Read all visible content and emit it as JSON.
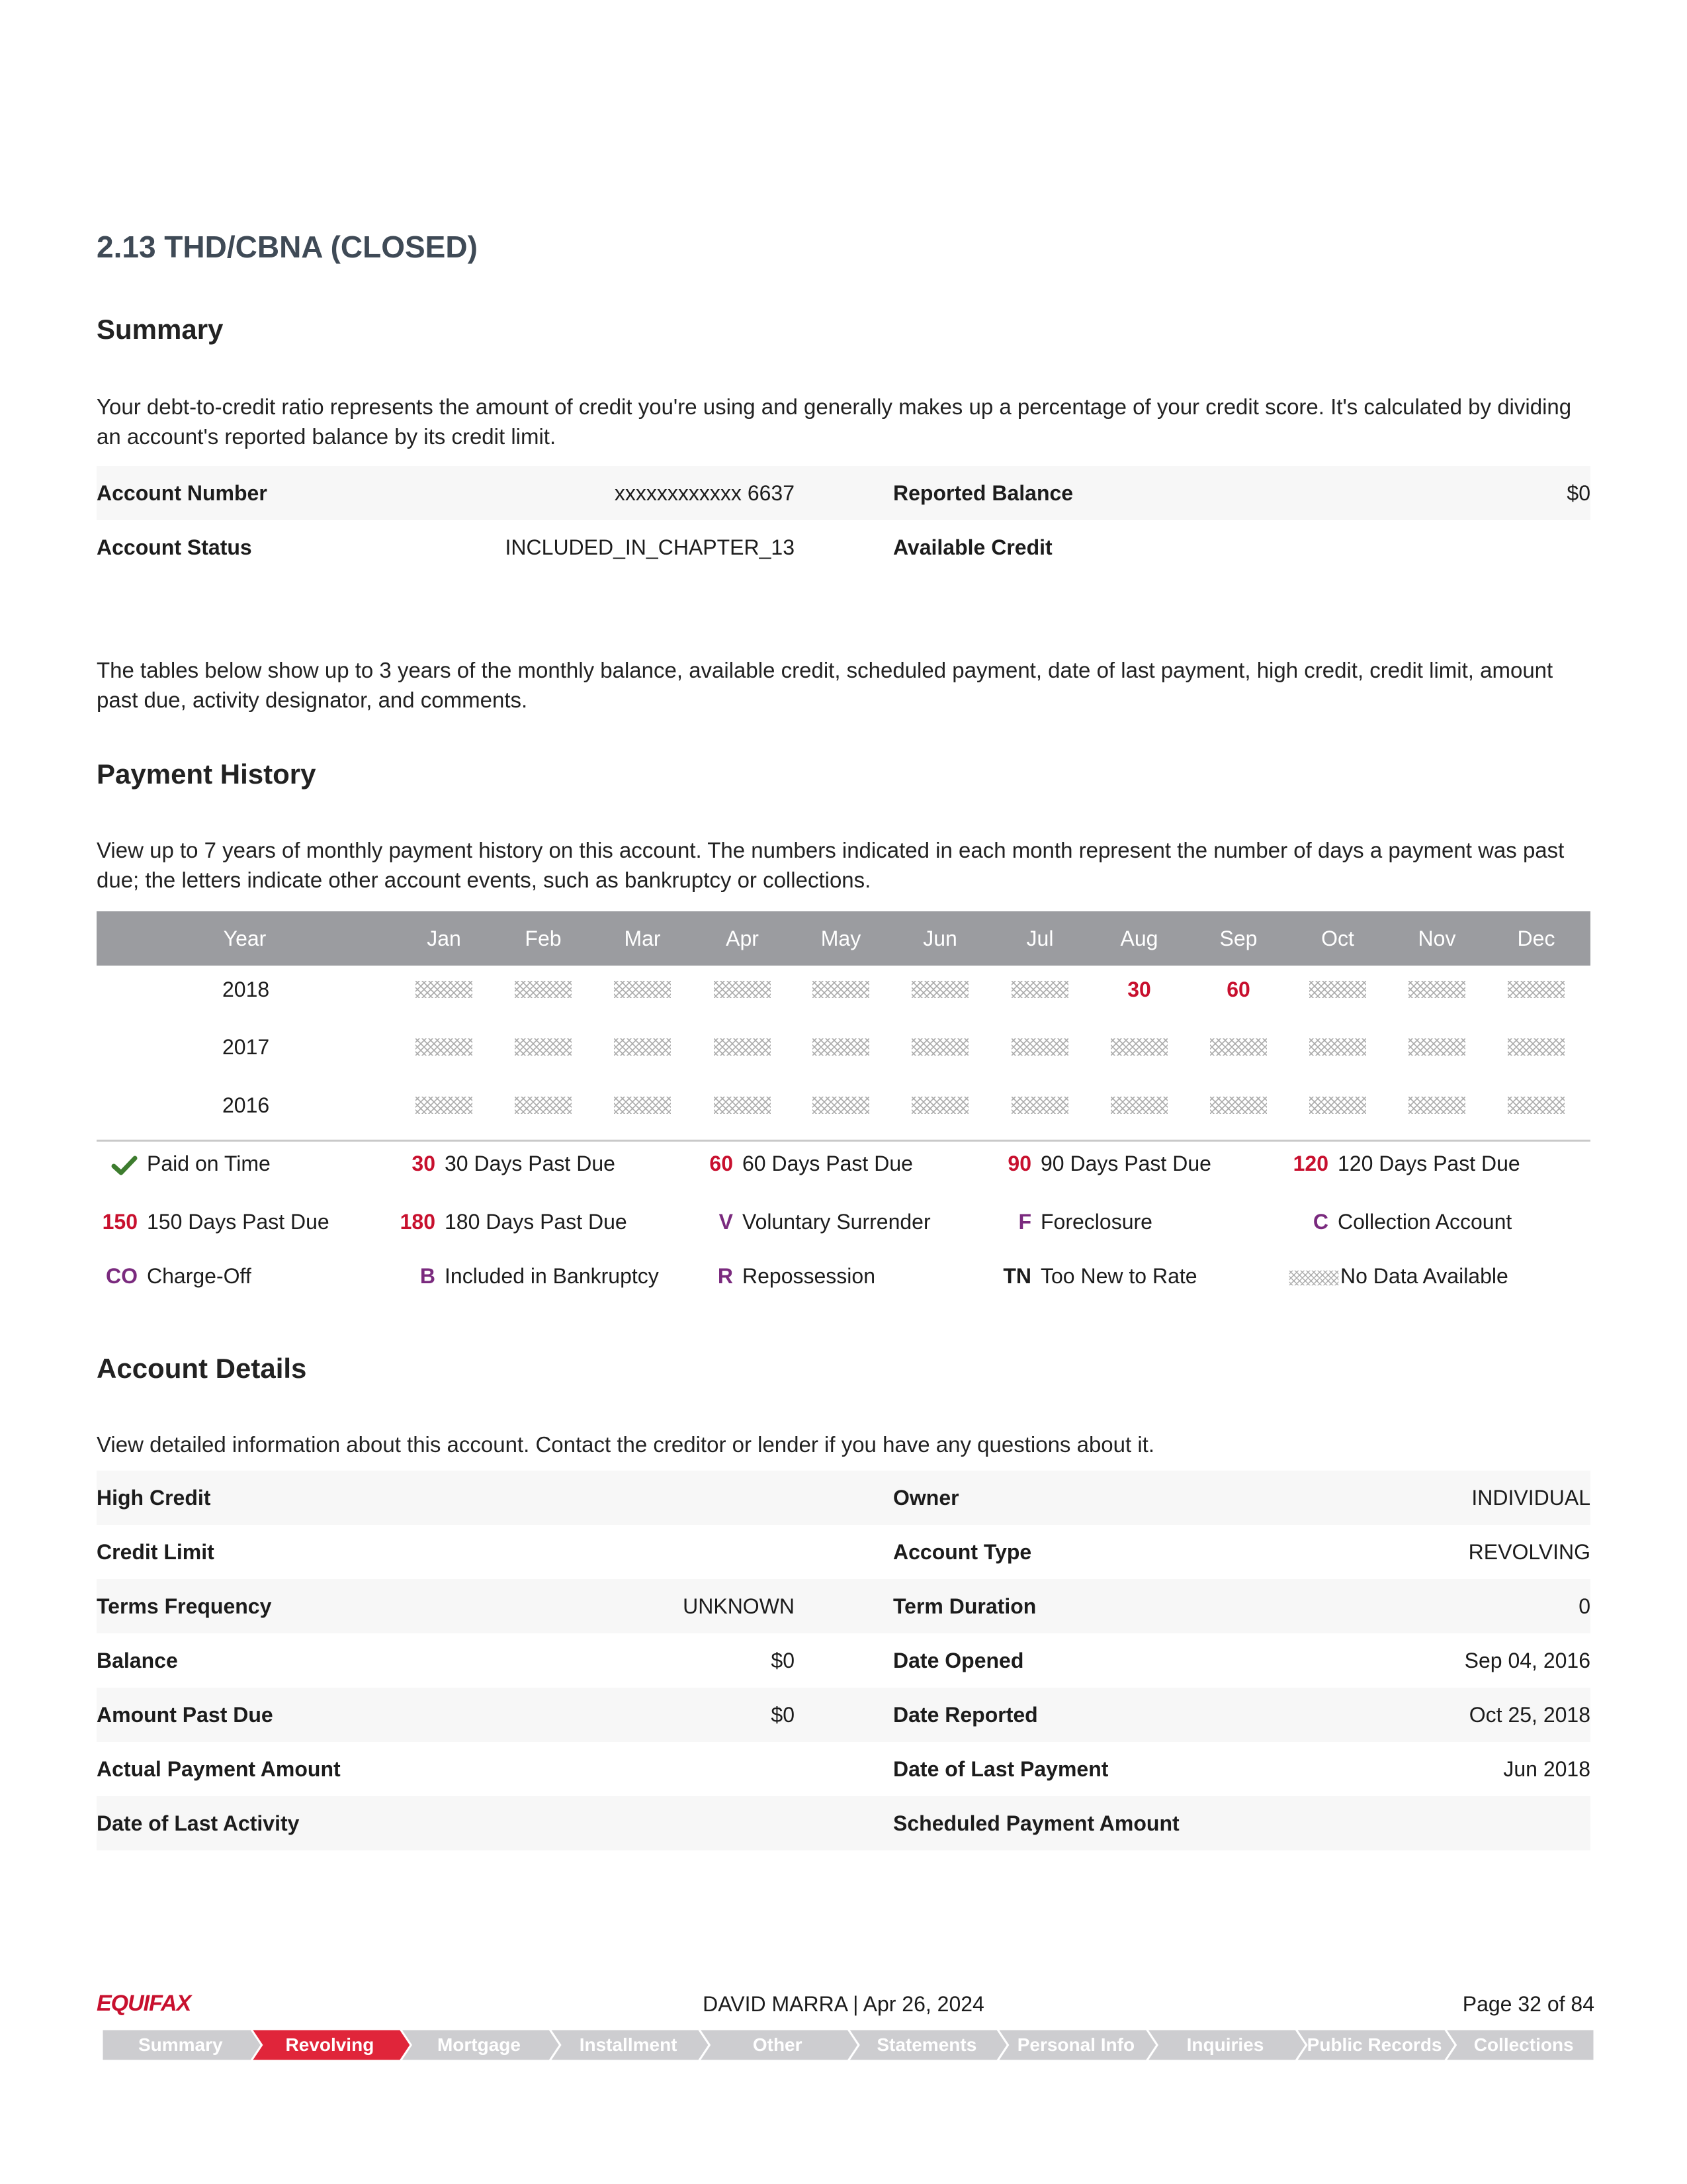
{
  "section_title": "2.13 THD/CBNA (CLOSED)",
  "summary": {
    "heading": "Summary",
    "description": "Your debt-to-credit ratio represents the amount of credit you're using and generally makes up a percentage of your credit score. It's calculated by dividing an account's reported balance by its credit limit.",
    "rows": [
      {
        "label1": "Account Number",
        "value1": "xxxxxxxxxxxx 6637",
        "label2": "Reported Balance",
        "value2": "$0"
      },
      {
        "label1": "Account Status",
        "value1": "INCLUDED_IN_CHAPTER_13",
        "label2": "Available Credit",
        "value2": ""
      }
    ]
  },
  "tables_note": "The tables below show up to 3 years of the monthly balance, available credit, scheduled payment, date of last payment, high credit, credit limit, amount past due, activity designator, and comments.",
  "payment_history": {
    "heading": "Payment History",
    "description": "View up to 7 years of monthly payment history on this account. The numbers indicated in each month represent the number of days a payment was past due; the letters indicate other account events, such as bankruptcy or collections.",
    "columns": [
      "Year",
      "Jan",
      "Feb",
      "Mar",
      "Apr",
      "May",
      "Jun",
      "Jul",
      "Aug",
      "Sep",
      "Oct",
      "Nov",
      "Dec"
    ],
    "rows": [
      {
        "year": "2018",
        "months": [
          "ND",
          "ND",
          "ND",
          "ND",
          "ND",
          "ND",
          "ND",
          "30",
          "60",
          "ND",
          "ND",
          "ND"
        ]
      },
      {
        "year": "2017",
        "months": [
          "ND",
          "ND",
          "ND",
          "ND",
          "ND",
          "ND",
          "ND",
          "ND",
          "ND",
          "ND",
          "ND",
          "ND"
        ]
      },
      {
        "year": "2016",
        "months": [
          "ND",
          "ND",
          "ND",
          "ND",
          "ND",
          "ND",
          "ND",
          "ND",
          "ND",
          "ND",
          "ND",
          "ND"
        ]
      }
    ],
    "legend": [
      {
        "code": "",
        "icon": "checkmark-icon",
        "label": "Paid on Time",
        "color": "red"
      },
      {
        "code": "30",
        "label": "30 Days Past Due",
        "color": "red"
      },
      {
        "code": "60",
        "label": "60 Days Past Due",
        "color": "red"
      },
      {
        "code": "90",
        "label": "90 Days Past Due",
        "color": "red"
      },
      {
        "code": "120",
        "label": "120 Days Past Due",
        "color": "red"
      },
      {
        "code": "150",
        "label": "150 Days Past Due",
        "color": "red"
      },
      {
        "code": "180",
        "label": "180 Days Past Due",
        "color": "red"
      },
      {
        "code": "V",
        "label": "Voluntary Surrender",
        "color": "purple"
      },
      {
        "code": "F",
        "label": "Foreclosure",
        "color": "purple"
      },
      {
        "code": "C",
        "label": "Collection Account",
        "color": "purple"
      },
      {
        "code": "CO",
        "label": "Charge-Off",
        "color": "purple"
      },
      {
        "code": "B",
        "label": "Included in Bankruptcy",
        "color": "purple"
      },
      {
        "code": "R",
        "label": "Repossession",
        "color": "purple"
      },
      {
        "code": "TN",
        "label": "Too New to Rate",
        "color": "dark"
      },
      {
        "code": "",
        "icon": "no-data-pattern-icon",
        "label": "No Data Available",
        "color": "dark"
      }
    ]
  },
  "account_details": {
    "heading": "Account Details",
    "description": "View detailed information about this account. Contact the creditor or lender if you have any questions about it.",
    "rows": [
      {
        "label1": "High Credit",
        "value1": "",
        "label2": "Owner",
        "value2": "INDIVIDUAL"
      },
      {
        "label1": "Credit Limit",
        "value1": "",
        "label2": "Account Type",
        "value2": "REVOLVING"
      },
      {
        "label1": "Terms Frequency",
        "value1": "UNKNOWN",
        "label2": "Term Duration",
        "value2": "0"
      },
      {
        "label1": "Balance",
        "value1": "$0",
        "label2": "Date Opened",
        "value2": "Sep 04, 2016"
      },
      {
        "label1": "Amount Past Due",
        "value1": "$0",
        "label2": "Date Reported",
        "value2": "Oct 25, 2018"
      },
      {
        "label1": "Actual Payment Amount",
        "value1": "",
        "label2": "Date of Last Payment",
        "value2": "Jun 2018"
      },
      {
        "label1": "Date of Last Activity",
        "value1": "",
        "label2": "Scheduled Payment Amount",
        "value2": ""
      }
    ]
  },
  "footer": {
    "logo": "EQUIFAX",
    "center": "DAVID MARRA | Apr 26, 2024",
    "page": "Page 32 of 84",
    "nav": [
      {
        "label": "Summary",
        "active": false
      },
      {
        "label": "Revolving",
        "active": true
      },
      {
        "label": "Mortgage",
        "active": false
      },
      {
        "label": "Installment",
        "active": false
      },
      {
        "label": "Other",
        "active": false
      },
      {
        "label": "Statements",
        "active": false
      },
      {
        "label": "Personal Info",
        "active": false
      },
      {
        "label": "Inquiries",
        "active": false
      },
      {
        "label": "Public Records",
        "active": false
      },
      {
        "label": "Collections",
        "active": false
      }
    ],
    "colors": {
      "active": "#e0253a",
      "inactive": "#cdcdd0",
      "brand": "#c8102e"
    }
  }
}
